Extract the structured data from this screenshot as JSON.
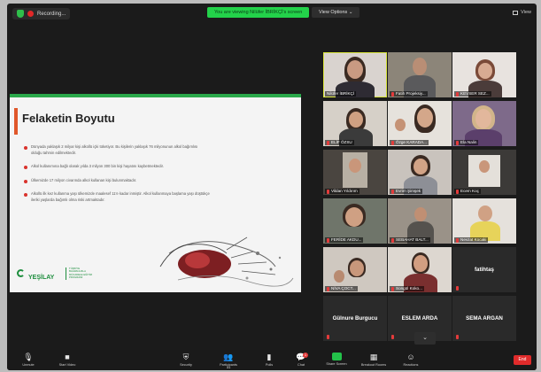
{
  "topbar": {
    "recording_label": "Recording...",
    "viewing_banner": "You are viewing Nilüfer İBRİKÇİ's screen",
    "view_options": "View Options",
    "view_label": "View"
  },
  "slide": {
    "title": "Felaketin Boyutu",
    "bullets": [
      "Dünyada yaklaşık 2 milyar kişi alkollü içki tüketiyor. Bu kişilerin yaklaşık 76 milyonunun alkol bağımlısı olduğu tahmin edilmektedir.",
      "Alkol kullanımına bağlı olarak yılda 3 milyon 300 bin kişi hayatını kaybetmektedir.",
      "Ülkemizde 17 milyon civarında alkol kullanan kişi bulunmaktadır.",
      "Alkollü ilk kez kullanma yaşı ülkemizde maalesef 11'e kadar inmiştir. Alkol kullanmaya başlama yaşı düştükçe ileriki yaşlarda bağımlı olma riski artmaktadır."
    ],
    "logo_text": "YEŞİLAY",
    "logo_sub": "TÜRKİYE BAĞIMLILIKLA MÜCADELE EĞİTİM PROGRAMI",
    "accent_color": "#e0572a",
    "brand_color": "#2aa84a"
  },
  "participants": [
    {
      "name": "Nilüfer İBRİKÇİ",
      "muted": false,
      "video": true
    },
    {
      "name": "Fatih Projeksiy...",
      "muted": true,
      "video": true
    },
    {
      "name": "KEVSER SEZ...",
      "muted": true,
      "video": true
    },
    {
      "name": "ELİF ÖZSU",
      "muted": true,
      "video": true
    },
    {
      "name": "Özge KARADA...",
      "muted": true,
      "video": true
    },
    {
      "name": "Ela Nalin",
      "muted": true,
      "video": true
    },
    {
      "name": "Vildan Yıldırım",
      "muted": true,
      "video": true
    },
    {
      "name": "Evrim Şimşek",
      "muted": true,
      "video": true
    },
    {
      "name": "Ecem Koç",
      "muted": true,
      "video": true
    },
    {
      "name": "FERİDE AKDU...",
      "muted": true,
      "video": true
    },
    {
      "name": "SEBAHAT BALT...",
      "muted": true,
      "video": true
    },
    {
      "name": "Nevzat Kocaki",
      "muted": true,
      "video": true
    },
    {
      "name": "NİVA ÇOCT...",
      "muted": true,
      "video": true
    },
    {
      "name": "Songül Koko...",
      "muted": true,
      "video": true
    },
    {
      "name": "fatihtaş",
      "muted": true,
      "video": false
    },
    {
      "name": "Gülnure Burgucu",
      "muted": true,
      "video": false
    },
    {
      "name": "ESLEM ARDA",
      "muted": true,
      "video": false
    },
    {
      "name": "SEMA ARGAN",
      "muted": true,
      "video": false
    }
  ],
  "toolbar": {
    "items": [
      {
        "label": "Unmute",
        "icon": "mic-icon"
      },
      {
        "label": "Start Video",
        "icon": "video-icon"
      },
      {
        "label": "Security",
        "icon": "shield-icon"
      },
      {
        "label": "Participants",
        "icon": "participants-icon",
        "count": "31"
      },
      {
        "label": "Polls",
        "icon": "polls-icon"
      },
      {
        "label": "Chat",
        "icon": "chat-icon",
        "badge": "1"
      },
      {
        "label": "Share Screen",
        "icon": "share-screen-icon"
      },
      {
        "label": "Breakout Rooms",
        "icon": "breakout-icon"
      },
      {
        "label": "Reactions",
        "icon": "reactions-icon"
      }
    ],
    "end_label": "End"
  }
}
